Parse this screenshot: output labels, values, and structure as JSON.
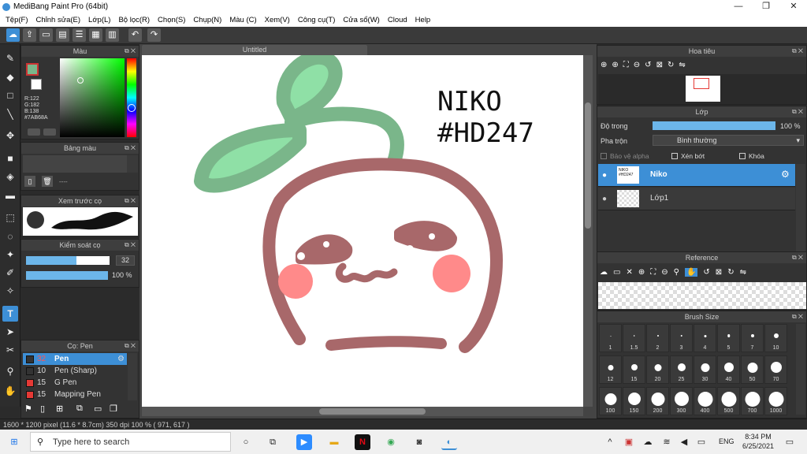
{
  "app": {
    "title": "MediBang Paint Pro (64bit)"
  },
  "window_controls": {
    "minimize": "—",
    "maximize": "❐",
    "close": "✕"
  },
  "menu": [
    "Tệp(F)",
    "Chỉnh sửa(E)",
    "Lớp(L)",
    "Bộ lọc(R)",
    "Chọn(S)",
    "Chụp(N)",
    "Màu (C)",
    "Xem(V)",
    "Công cụ(T)",
    "Cửa sổ(W)",
    "Cloud",
    "Help"
  ],
  "panels": {
    "color": {
      "title": "Màu",
      "r": "R:122",
      "g": "G:182",
      "b": "B:138",
      "hex": "#7AB68A"
    },
    "palette": {
      "title": "Bảng màu",
      "placeholder": "----"
    },
    "brush_preview": {
      "title": "Xem trước cọ"
    },
    "brush_control": {
      "title": "Kiểm soát cọ",
      "size": "32",
      "opacity": "100 %",
      "size_fraction": 0.6,
      "opacity_fraction": 1.0
    },
    "brush": {
      "title": "Cọ: Pen",
      "items": [
        {
          "size": "32",
          "name": "Pen",
          "color": "#333333"
        },
        {
          "size": "10",
          "name": "Pen (Sharp)",
          "color": "#333333"
        },
        {
          "size": "15",
          "name": "G Pen",
          "color": "#e53935"
        },
        {
          "size": "15",
          "name": "Mapping Pen",
          "color": "#e53935"
        }
      ]
    },
    "navigator": {
      "title": "Hoa tiêu"
    },
    "layer": {
      "title": "Lớp",
      "opacity_label": "Độ trong",
      "opacity_value": "100 %",
      "blend_label": "Pha trộn",
      "blend_value": "Bình thường",
      "protect_alpha": "Bảo vệ alpha",
      "clipping": "Xén bớt",
      "lock": "Khóa",
      "layers": [
        {
          "name": "Niko",
          "thumb": "NIKO #HD247"
        },
        {
          "name": "Lớp1",
          "thumb": ""
        }
      ]
    },
    "reference": {
      "title": "Reference"
    },
    "brush_size": {
      "title": "Brush Size",
      "sizes": [
        "1",
        "1.5",
        "2",
        "3",
        "4",
        "5",
        "7",
        "10",
        "12",
        "15",
        "20",
        "25",
        "30",
        "40",
        "50",
        "70",
        "100",
        "150",
        "200",
        "300",
        "400",
        "500",
        "700",
        "1000"
      ]
    }
  },
  "document": {
    "tab": "Untitled",
    "text_line1": "NIKO",
    "text_line2": "#HD247"
  },
  "colors": {
    "leaf_outline": "#7AB68A",
    "leaf_fill": "#8FE0A6",
    "face": "#A8686A",
    "cheek": "#FF8A8A",
    "accent_blue": "#3d8fd6"
  },
  "status": {
    "text": "1600 * 1200 pixel  (11.6 * 8.7cm)  350 dpi  100 %  ( 971, 617 )"
  },
  "taskbar": {
    "search_placeholder": "Type here to search",
    "time": "8:34 PM",
    "date": "6/25/2021",
    "lang": "ENG"
  }
}
